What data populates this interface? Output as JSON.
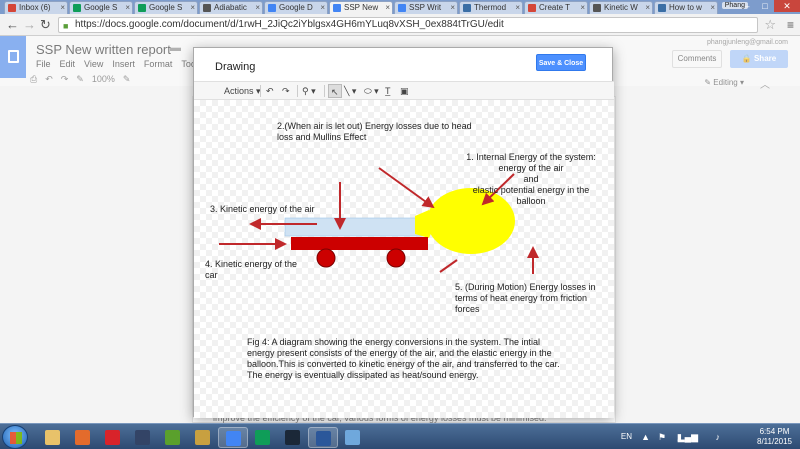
{
  "browser": {
    "tabs": [
      {
        "label": "Inbox (6)",
        "color": "#d44638",
        "active": false
      },
      {
        "label": "Google S",
        "color": "#0f9d58",
        "active": false
      },
      {
        "label": "Google S",
        "color": "#0f9d58",
        "active": false
      },
      {
        "label": "Adiabatic",
        "color": "#555555",
        "active": false
      },
      {
        "label": "Google D",
        "color": "#4285f4",
        "active": false
      },
      {
        "label": "SSP New",
        "color": "#4285f4",
        "active": true
      },
      {
        "label": "SSP Writ",
        "color": "#4285f4",
        "active": false
      },
      {
        "label": "Thermod",
        "color": "#3a6ea5",
        "active": false
      },
      {
        "label": "Create T",
        "color": "#d44638",
        "active": false
      },
      {
        "label": "Kinetic W",
        "color": "#555555",
        "active": false
      },
      {
        "label": "How to w",
        "color": "#3a6ea5",
        "active": false
      }
    ],
    "user_badge": "Phang",
    "url": "https://docs.google.com/document/d/1rwH_2JiQc2iYblgsx4GH6mYLuq8vXSH_0ex884tTrGU/edit"
  },
  "docs": {
    "title": "SSP New written report",
    "menu": [
      "File",
      "Edit",
      "View",
      "Insert",
      "Format",
      "Tools"
    ],
    "user_email": "phangjunleng@gmail.com",
    "comments_label": "Comments",
    "share_label": "Share",
    "editing_label": "Editing",
    "zoom": "100%",
    "body_text": "improve the efficiency of the car, various forms of energy losses must be minimised."
  },
  "drawing": {
    "title": "Drawing",
    "save_close": "Save & Close",
    "toolbar": {
      "actions": "Actions"
    },
    "labels": {
      "loss_air": "2.(When air is let out) Energy losses due to head loss and Mullins Effect",
      "internal_line1": "1.      Internal Energy of the system: energy of the air",
      "internal_line2": "and",
      "internal_line3": "elastic potential energy in the balloon",
      "kinetic_air": "3. Kinetic energy of the air",
      "kinetic_car": "4. Kinetic energy of the car",
      "loss_motion": "5. (During Motion) Energy losses in terms of heat energy from friction forces",
      "caption": "Fig 4: A diagram showing the energy conversions in the system. The intial energy present consists of the energy of the air, and the elastic energy in the balloon.This is converted to kinetic energy of the air, and transferred to the car. The energy is eventually dissipated as heat/sound energy."
    },
    "colors": {
      "arrow": "#c0282b",
      "car": "#cc0000",
      "balloon": "#ffff00",
      "air": "#cfe2f3"
    }
  },
  "taskbar": {
    "apps": [
      {
        "name": "explorer-app",
        "color": "#e8c26a",
        "open": false
      },
      {
        "name": "media-player-app",
        "color": "#e36b2c",
        "open": false
      },
      {
        "name": "pin-app",
        "color": "#d8232a",
        "open": false
      },
      {
        "name": "steam-app",
        "color": "#334466",
        "open": false
      },
      {
        "name": "w-app",
        "color": "#5aa02c",
        "open": false
      },
      {
        "name": "game-app",
        "color": "#c8a040",
        "open": false
      },
      {
        "name": "chrome-app",
        "color": "#4285f4",
        "open": true
      },
      {
        "name": "docs-app",
        "color": "#0f9d58",
        "open": false
      },
      {
        "name": "steam-app-2",
        "color": "#1b2838",
        "open": false
      },
      {
        "name": "word-app",
        "color": "#2b579a",
        "open": true
      },
      {
        "name": "paint-app",
        "color": "#6fa8dc",
        "open": false
      }
    ],
    "lang": "EN",
    "time": "6:54 PM",
    "date": "8/11/2015"
  }
}
